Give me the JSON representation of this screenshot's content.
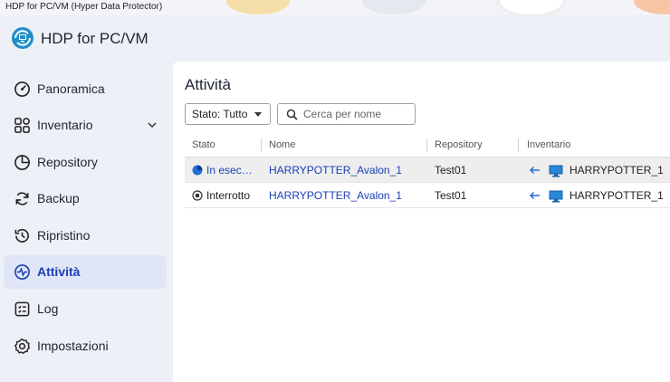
{
  "window": {
    "title": "HDP for PC/VM (Hyper Data Protector)"
  },
  "app": {
    "title": "HDP for PC/VM"
  },
  "sidebar": {
    "items": [
      {
        "label": "Panoramica",
        "icon": "gauge-icon"
      },
      {
        "label": "Inventario",
        "icon": "grid-icon",
        "expandable": true
      },
      {
        "label": "Repository",
        "icon": "pie-chart-icon"
      },
      {
        "label": "Backup",
        "icon": "backup-sync-icon"
      },
      {
        "label": "Ripristino",
        "icon": "restore-icon"
      },
      {
        "label": "Attività",
        "icon": "activity-icon",
        "active": true
      },
      {
        "label": "Log",
        "icon": "log-icon"
      },
      {
        "label": "Impostazioni",
        "icon": "gear-icon"
      }
    ]
  },
  "main": {
    "title": "Attività",
    "filter": {
      "label": "Stato: Tutto"
    },
    "search": {
      "placeholder": "Cerca per nome"
    },
    "table": {
      "columns": [
        "Stato",
        "Nome",
        "Repository",
        "Inventario"
      ],
      "rows": [
        {
          "status": "In esecuzione",
          "status_icon": "running-icon",
          "name": "HARRYPOTTER_Avalon_1",
          "repository": "Test01",
          "inventory": "HARRYPOTTER_1"
        },
        {
          "status": "Interrotto",
          "status_icon": "stopped-icon",
          "name": "HARRYPOTTER_Avalon_1",
          "repository": "Test01",
          "inventory": "HARRYPOTTER_1"
        }
      ]
    }
  },
  "colors": {
    "accent": "#1a3fb5",
    "active_bg": "#e0e6f7",
    "sidebar_bg": "#eef0f7"
  }
}
